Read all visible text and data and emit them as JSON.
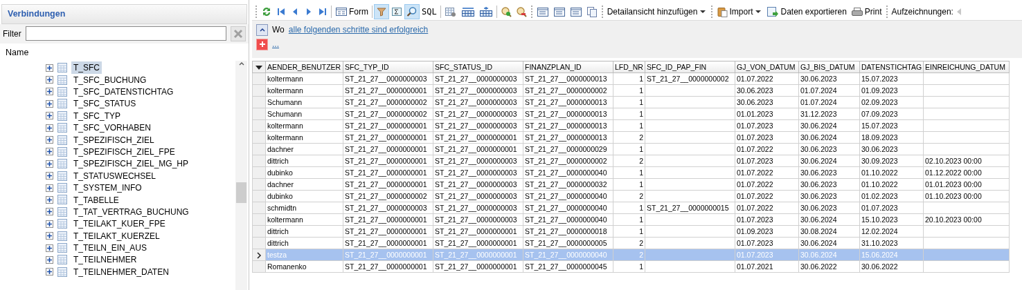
{
  "sidebar": {
    "title": "Verbindungen",
    "filter_label": "Filter",
    "column_header": "Name",
    "items": [
      {
        "label": "T_SFC",
        "selected": true,
        "expanded": false
      },
      {
        "label": "T_SFC_BUCHUNG",
        "selected": false,
        "expanded": false
      },
      {
        "label": "T_SFC_DATENSTICHTAG",
        "selected": false,
        "expanded": false
      },
      {
        "label": "T_SFC_STATUS",
        "selected": false,
        "expanded": false
      },
      {
        "label": "T_SFC_TYP",
        "selected": false,
        "expanded": false
      },
      {
        "label": "T_SFC_VORHABEN",
        "selected": false,
        "expanded": false
      },
      {
        "label": "T_SPEZIFISCH_ZIEL",
        "selected": false,
        "expanded": false
      },
      {
        "label": "T_SPEZIFISCH_ZIEL_FPE",
        "selected": false,
        "expanded": false
      },
      {
        "label": "T_SPEZIFISCH_ZIEL_MG_HP",
        "selected": false,
        "expanded": false
      },
      {
        "label": "T_STATUSWECHSEL",
        "selected": false,
        "expanded": false
      },
      {
        "label": "T_SYSTEM_INFO",
        "selected": false,
        "expanded": false
      },
      {
        "label": "T_TABELLE",
        "selected": false,
        "expanded": false
      },
      {
        "label": "T_TAT_VERTRAG_BUCHUNG",
        "selected": false,
        "expanded": false
      },
      {
        "label": "T_TEILAKT_KUER_FPE",
        "selected": false,
        "expanded": false
      },
      {
        "label": "T_TEILAKT_KUERZEL",
        "selected": false,
        "expanded": false
      },
      {
        "label": "T_TEILN_EIN_AUS",
        "selected": false,
        "expanded": false
      },
      {
        "label": "T_TEILNEHMER",
        "selected": false,
        "expanded": false
      },
      {
        "label": "T_TEILNEHMER_DATEN",
        "selected": false,
        "expanded": false
      }
    ]
  },
  "toolbar": {
    "form_label": "Form",
    "sql_label": "SQL",
    "toggles": [
      {
        "selected": true
      },
      {
        "selected": false
      },
      {
        "selected": true
      }
    ],
    "detail_view": "Detailansicht hinzufügen",
    "import": "Import",
    "export": "Daten exportieren",
    "print": "Print",
    "records": "Aufzeichnungen:"
  },
  "filter": {
    "where": "Wo",
    "condition": "alle folgenden schritte sind erfolgreich",
    "add": "..."
  },
  "table": {
    "columns": [
      "AENDER_BENUTZER",
      "SFC_TYP_ID",
      "SFC_STATUS_ID",
      "FINANZPLAN_ID",
      "LFD_NR",
      "SFC_ID_PAP_FIN",
      "GJ_VON_DATUM",
      "GJ_BIS_DATUM",
      "DATENSTICHTAG",
      "EINREICHUNG_DATUM"
    ],
    "rows": [
      {
        "selected": false,
        "cells": [
          "koltermann",
          "ST_21_27__0000000003",
          "ST_21_27__0000000003",
          "ST_21_27__0000000013",
          "1",
          "ST_21_27__0000000002",
          "01.07.2022",
          "30.06.2023",
          "15.07.2023",
          ""
        ]
      },
      {
        "selected": false,
        "cells": [
          "koltermann",
          "ST_21_27__0000000001",
          "ST_21_27__0000000003",
          "ST_21_27__0000000002",
          "1",
          "",
          "30.06.2023",
          "01.07.2024",
          "01.09.2023",
          ""
        ]
      },
      {
        "selected": false,
        "cells": [
          "Schumann",
          "ST_21_27__0000000002",
          "ST_21_27__0000000003",
          "ST_21_27__0000000013",
          "1",
          "",
          "30.06.2023",
          "01.07.2024",
          "02.09.2023",
          ""
        ]
      },
      {
        "selected": false,
        "cells": [
          "Schumann",
          "ST_21_27__0000000002",
          "ST_21_27__0000000003",
          "ST_21_27__0000000013",
          "1",
          "",
          "01.01.2023",
          "31.12.2023",
          "07.09.2023",
          ""
        ]
      },
      {
        "selected": false,
        "cells": [
          "koltermann",
          "ST_21_27__0000000001",
          "ST_21_27__0000000003",
          "ST_21_27__0000000013",
          "1",
          "",
          "01.07.2023",
          "30.06.2024",
          "15.07.2023",
          ""
        ]
      },
      {
        "selected": false,
        "cells": [
          "koltermann",
          "ST_21_27__0000000001",
          "ST_21_27__0000000001",
          "ST_21_27__0000000013",
          "2",
          "",
          "01.07.2023",
          "30.06.2024",
          "18.09.2023",
          ""
        ]
      },
      {
        "selected": false,
        "cells": [
          "dachner",
          "ST_21_27__0000000001",
          "ST_21_27__0000000001",
          "ST_21_27__0000000029",
          "1",
          "",
          "01.07.2022",
          "30.06.2023",
          "30.06.2023",
          ""
        ]
      },
      {
        "selected": false,
        "cells": [
          "dittrich",
          "ST_21_27__0000000001",
          "ST_21_27__0000000003",
          "ST_21_27__0000000002",
          "2",
          "",
          "01.07.2023",
          "30.06.2024",
          "30.09.2023",
          "02.10.2023 00:00"
        ]
      },
      {
        "selected": false,
        "cells": [
          "dubinko",
          "ST_21_27__0000000001",
          "ST_21_27__0000000003",
          "ST_21_27__0000000040",
          "1",
          "",
          "01.07.2022",
          "30.06.2023",
          "01.10.2022",
          "01.12.2022 00:00"
        ]
      },
      {
        "selected": false,
        "cells": [
          "dachner",
          "ST_21_27__0000000001",
          "ST_21_27__0000000003",
          "ST_21_27__0000000032",
          "1",
          "",
          "01.07.2022",
          "30.06.2023",
          "01.10.2022",
          "01.01.2023 00:00"
        ]
      },
      {
        "selected": false,
        "cells": [
          "dubinko",
          "ST_21_27__0000000002",
          "ST_21_27__0000000003",
          "ST_21_27__0000000040",
          "2",
          "",
          "01.07.2022",
          "30.06.2023",
          "01.02.2023",
          "01.10.2023 00:00"
        ]
      },
      {
        "selected": false,
        "cells": [
          "schmidtn",
          "ST_21_27__0000000003",
          "ST_21_27__0000000003",
          "ST_21_27__0000000040",
          "1",
          "ST_21_27__0000000015",
          "01.07.2022",
          "30.06.2023",
          "01.07.2023",
          ""
        ]
      },
      {
        "selected": false,
        "cells": [
          "koltermann",
          "ST_21_27__0000000001",
          "ST_21_27__0000000003",
          "ST_21_27__0000000040",
          "1",
          "",
          "01.07.2023",
          "30.06.2024",
          "15.10.2023",
          "20.10.2023 00:00"
        ]
      },
      {
        "selected": false,
        "cells": [
          "dittrich",
          "ST_21_27__0000000001",
          "ST_21_27__0000000001",
          "ST_21_27__0000000018",
          "1",
          "",
          "01.09.2023",
          "30.08.2024",
          "12.02.2024",
          ""
        ]
      },
      {
        "selected": false,
        "cells": [
          "dittrich",
          "ST_21_27__0000000001",
          "ST_21_27__0000000001",
          "ST_21_27__0000000005",
          "2",
          "",
          "01.07.2023",
          "30.06.2024",
          "31.10.2023",
          ""
        ]
      },
      {
        "selected": true,
        "cells": [
          "testza",
          "ST_21_27__0000000001",
          "ST_21_27__0000000001",
          "ST_21_27__0000000040",
          "2",
          "",
          "01.07.2023",
          "30.06.2024",
          "15.06.2024",
          ""
        ]
      },
      {
        "selected": false,
        "cells": [
          "Romanenko",
          "ST_21_27__0000000001",
          "ST_21_27__0000000001",
          "ST_21_27__0000000045",
          "1",
          "",
          "01.07.2021",
          "30.06.2022",
          "30.06.2022",
          ""
        ]
      }
    ]
  }
}
